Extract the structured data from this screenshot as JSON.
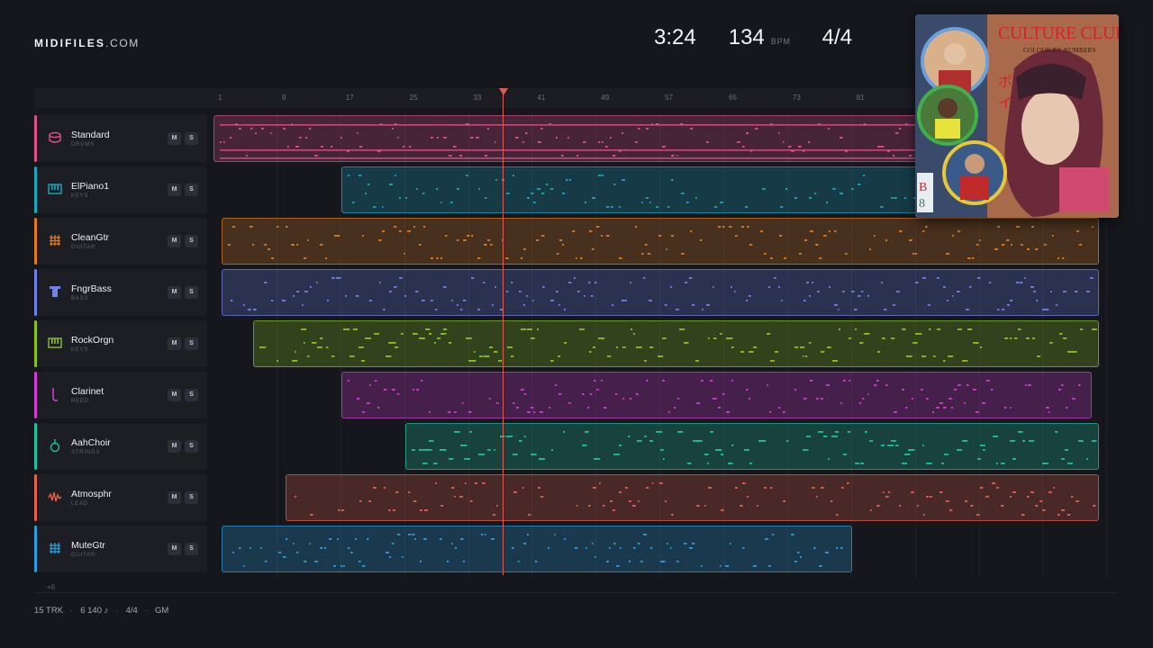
{
  "header": {
    "brand": "MIDIFILES",
    "tld": ".COM"
  },
  "stats": {
    "time": "3:24",
    "bpm": "134",
    "bpm_label": "BPM",
    "signature": "4/4"
  },
  "ruler": {
    "ticks": [
      "1",
      "9",
      "17",
      "25",
      "33",
      "41",
      "49",
      "57",
      "65",
      "73",
      "81"
    ]
  },
  "tracks": [
    {
      "name": "Standard",
      "sub": "DRUMS",
      "color": "#e0508a",
      "icon": "drum-icon",
      "mute": "M",
      "solo": "S"
    },
    {
      "name": "ElPiano1",
      "sub": "KEYS",
      "color": "#1aa7c2",
      "icon": "piano-keys-icon",
      "mute": "M",
      "solo": "S"
    },
    {
      "name": "CleanGtr",
      "sub": "GUITAR",
      "color": "#e07b1e",
      "icon": "guitar-grid-icon",
      "mute": "M",
      "solo": "S"
    },
    {
      "name": "FngrBass",
      "sub": "BASS",
      "color": "#6f82e8",
      "icon": "bass-icon",
      "mute": "M",
      "solo": "S"
    },
    {
      "name": "RockOrgn",
      "sub": "KEYS",
      "color": "#8cc21e",
      "icon": "organ-keys-icon",
      "mute": "M",
      "solo": "S"
    },
    {
      "name": "Clarinet",
      "sub": "REED",
      "color": "#d63ad6",
      "icon": "clarinet-icon",
      "mute": "M",
      "solo": "S"
    },
    {
      "name": "AahChoir",
      "sub": "STRINGS",
      "color": "#1ec2a0",
      "icon": "choir-icon",
      "mute": "M",
      "solo": "S"
    },
    {
      "name": "Atmosphr",
      "sub": "LEAD",
      "color": "#e8604a",
      "icon": "waveform-icon",
      "mute": "M",
      "solo": "S"
    },
    {
      "name": "MuteGtr",
      "sub": "GUITAR",
      "color": "#2a9ee0",
      "icon": "mute-guitar-icon",
      "mute": "M",
      "solo": "S"
    }
  ],
  "more_tracks": "+6",
  "footer": {
    "tracks": "15 TRK",
    "notes": "6 140 ♪",
    "signature": "4/4",
    "format": "GM"
  },
  "cover": {
    "title": "CULTURE CLUB",
    "subtitle": "COLOUR BY NUMBERS"
  }
}
